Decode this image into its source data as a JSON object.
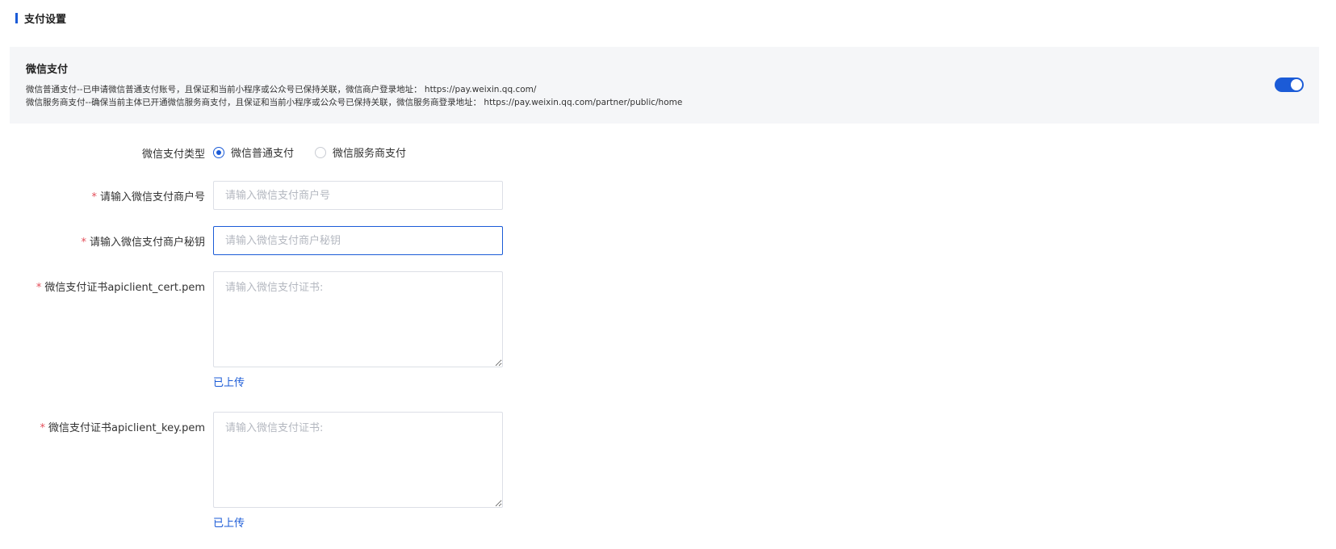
{
  "section": {
    "title": "支付设置"
  },
  "wechat_panel": {
    "title": "微信支付",
    "desc1": "微信普通支付--已申请微信普通支付账号，且保证和当前小程序或公众号已保持关联，微信商户登录地址： https://pay.weixin.qq.com/",
    "desc2": "微信服务商支付--确保当前主体已开通微信服务商支付，且保证和当前小程序或公众号已保持关联，微信服务商登录地址： https://pay.weixin.qq.com/partner/public/home",
    "enabled": true,
    "toggle_color": "#1b5bd7"
  },
  "form": {
    "pay_type": {
      "label": "微信支付类型",
      "options": [
        "微信普通支付",
        "微信服务商支付"
      ],
      "selected": "微信普通支付"
    },
    "merchant_id": {
      "label": "请输入微信支付商户号",
      "placeholder": "请输入微信支付商户号",
      "value": ""
    },
    "merchant_secret": {
      "label": "请输入微信支付商户秘钥",
      "placeholder": "请输入微信支付商户秘钥",
      "value": ""
    },
    "cert_pem": {
      "label": "微信支付证书apiclient_cert.pem",
      "placeholder": "请输入微信支付证书:",
      "status": "已上传"
    },
    "key_pem": {
      "label": "微信支付证书apiclient_key.pem",
      "placeholder": "请输入微信支付证书:",
      "status": "已上传"
    },
    "required_mark": "*"
  },
  "colors": {
    "accent": "#1b5bd7",
    "required": "#e34d59",
    "panel_bg": "#f5f6f8"
  }
}
